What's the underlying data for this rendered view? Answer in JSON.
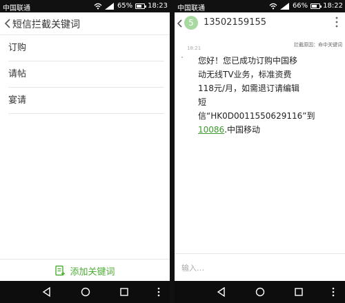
{
  "left": {
    "status": {
      "carrier": "中国联通",
      "battery": "65%",
      "time": "18:23",
      "battery_level": 0.65
    },
    "appbar": {
      "title": "短信拦截关键词"
    },
    "keywords": [
      "订购",
      "请帖",
      "宴请"
    ],
    "add_button": {
      "label": "添加关键词"
    }
  },
  "right": {
    "status": {
      "carrier": "中国联通",
      "battery": "66%",
      "time": "18:22",
      "battery_level": 0.66
    },
    "header": {
      "avatar_initial": "5",
      "sender": "13502159155"
    },
    "block_reason": "拦截原因：命中关键词",
    "time": "18:21",
    "message": {
      "line1": "您好！您已成功订购中国移",
      "line2": "动无线TV业务，标准资费",
      "line3": "118元/月，如需退订请编辑",
      "line4": "短",
      "line5": "信“HK0D0011550629116”到",
      "link": "10086",
      "tail": ".中国移动"
    },
    "input_placeholder": "输入…"
  },
  "colors": {
    "accent": "#4cad33",
    "status_bar": "#111111",
    "nav_bar": "#0d0d0d"
  },
  "icons": [
    "back-icon",
    "add-note-icon",
    "wifi-icon",
    "signal-icon",
    "battery-icon",
    "nav-back-icon",
    "nav-home-icon",
    "nav-recents-icon",
    "nav-menu-icon",
    "more-icon"
  ]
}
